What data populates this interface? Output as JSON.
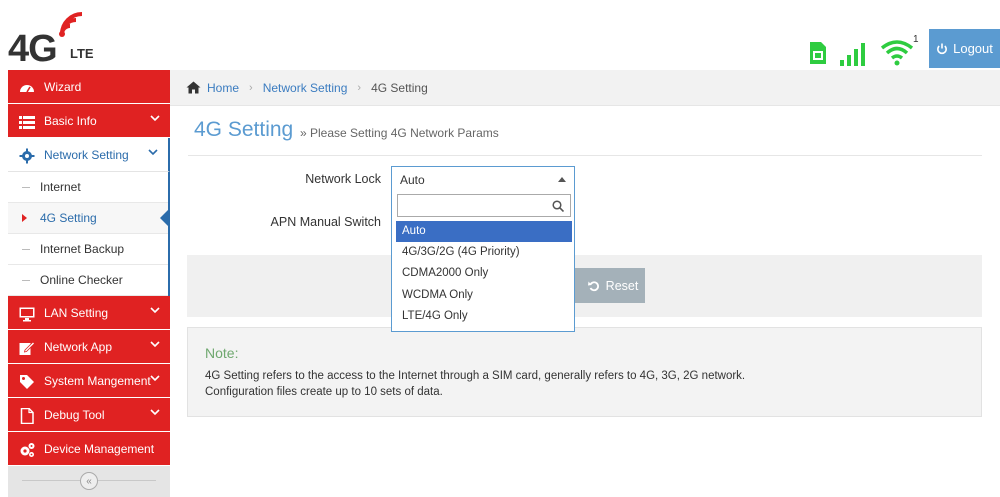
{
  "brand": {
    "logo_main": "4G",
    "logo_sub": "LTE"
  },
  "header": {
    "sim_icon": "sim-card-icon",
    "signal_icon": "signal-bars-icon",
    "wifi_icon": "wifi-icon",
    "wifi_count": "1",
    "logout_label": "Logout",
    "status_color": "#2ecc40",
    "logout_color": "#5b9bd1"
  },
  "sidebar": {
    "items": [
      {
        "label": "Wizard",
        "icon": "dashboard-icon"
      },
      {
        "label": "Basic Info",
        "icon": "list-icon"
      },
      {
        "label": "Network Setting",
        "icon": "gear-icon"
      },
      {
        "label": "LAN Setting",
        "icon": "monitor-icon"
      },
      {
        "label": "Network App",
        "icon": "edit-icon"
      },
      {
        "label": "System Mangement",
        "icon": "tag-icon"
      },
      {
        "label": "Debug Tool",
        "icon": "file-icon"
      },
      {
        "label": "Device Management",
        "icon": "gears-icon"
      }
    ],
    "submenu": [
      {
        "label": "Internet"
      },
      {
        "label": "4G Setting"
      },
      {
        "label": "Internet Backup"
      },
      {
        "label": "Online Checker"
      }
    ],
    "collapse_glyph": "«",
    "accent_color": "#e02222"
  },
  "breadcrumb": {
    "home": "Home",
    "section": "Network Setting",
    "current": "4G Setting"
  },
  "page": {
    "title": "4G Setting",
    "subtitle": "» Please Setting 4G Network Params"
  },
  "form": {
    "network_lock_label": "Network Lock",
    "network_lock_value": "Auto",
    "apn_label": "APN Manual Switch",
    "dropdown_search_value": "",
    "options": [
      "Auto",
      "4G/3G/2G (4G Priority)",
      "CDMA2000 Only",
      "WCDMA Only",
      "LTE/4G Only"
    ],
    "selected_option": "Auto"
  },
  "buttons": {
    "reset_label": "Reset"
  },
  "note": {
    "title": "Note:",
    "line1": "4G Setting refers to the access to the Internet through a SIM card, generally refers to 4G, 3G, 2G network.",
    "line2": "Configuration files create up to 10 sets of data."
  }
}
